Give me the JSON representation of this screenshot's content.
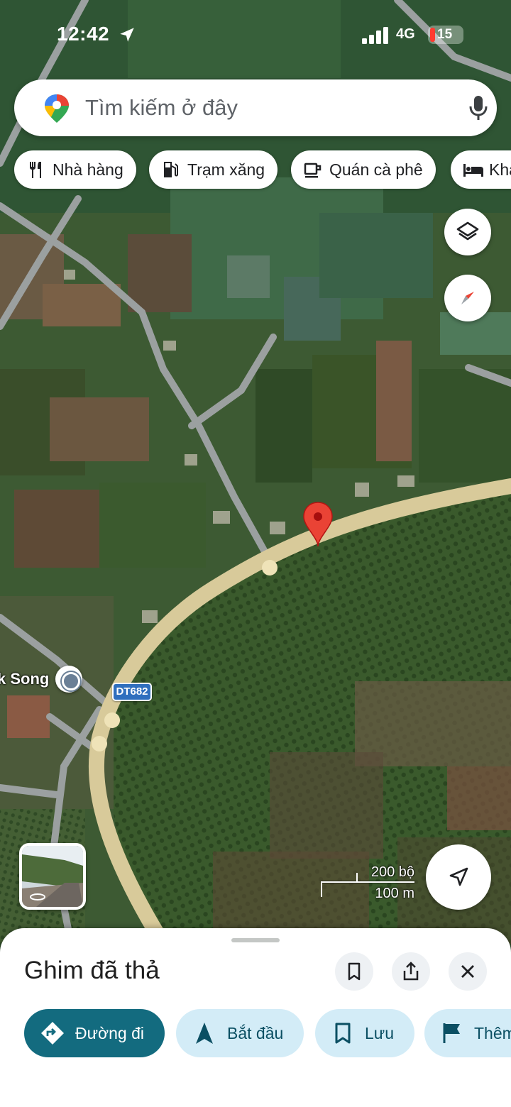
{
  "status_bar": {
    "time": "12:42",
    "network": "4G",
    "battery": "15"
  },
  "search": {
    "placeholder": "Tìm kiếm ở đây"
  },
  "chips": [
    {
      "label": "Nhà hàng",
      "icon": "restaurant-icon"
    },
    {
      "label": "Trạm xăng",
      "icon": "gas-station-icon"
    },
    {
      "label": "Quán cà phê",
      "icon": "coffee-icon"
    },
    {
      "label": "Kha",
      "icon": "hotel-icon"
    }
  ],
  "map": {
    "place_label": "k Song",
    "road_shield": "DT682",
    "scale": {
      "imperial": "200 bộ",
      "metric": "100 m"
    }
  },
  "sheet": {
    "title": "Ghim đã thả",
    "actions": [
      {
        "label": "Đường đi",
        "icon": "directions-icon"
      },
      {
        "label": "Bắt đầu",
        "icon": "navigation-arrow-icon"
      },
      {
        "label": "Lưu",
        "icon": "bookmark-icon"
      },
      {
        "label": "Thêm",
        "icon": "flag-icon"
      }
    ]
  },
  "colors": {
    "primary_action": "#136b7f",
    "secondary_action": "#d3ecf7",
    "pin": "#ea4335"
  }
}
